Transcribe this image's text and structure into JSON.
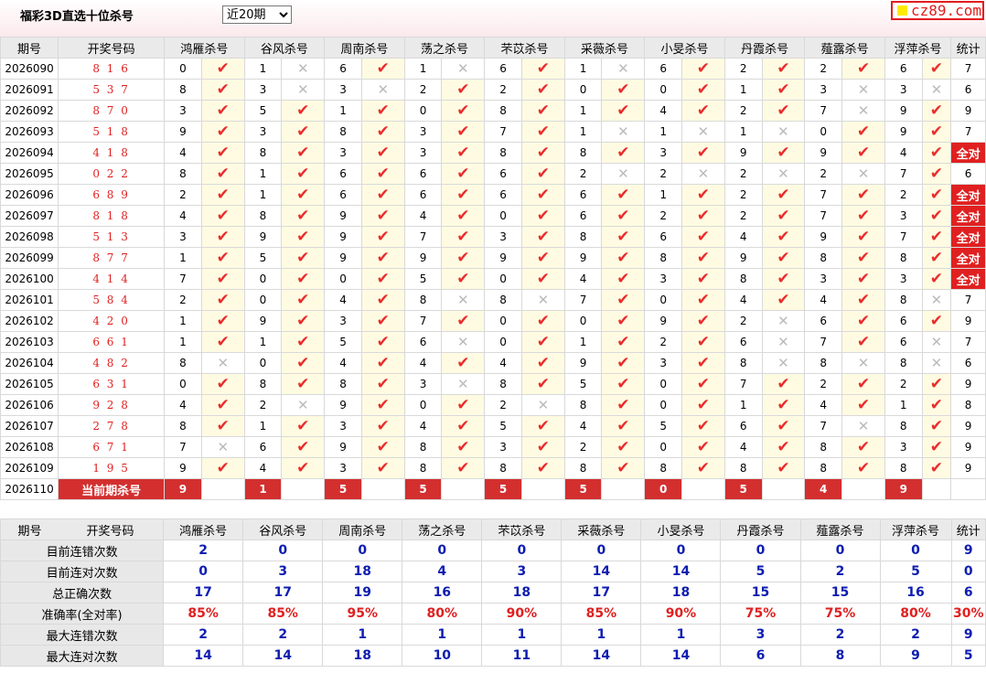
{
  "header": {
    "title": "福彩3D直选十位杀号",
    "period_select": "近20期",
    "logo_text": "cz89.com"
  },
  "columns": [
    "期号",
    "开奖号码",
    "鸿雁杀号",
    "谷风杀号",
    "周南杀号",
    "荡之杀号",
    "芣苡杀号",
    "采薇杀号",
    "小旻杀号",
    "丹霞杀号",
    "薤露杀号",
    "浮萍杀号",
    "统计"
  ],
  "experts": [
    "鸿雁杀号",
    "谷风杀号",
    "周南杀号",
    "荡之杀号",
    "芣苡杀号",
    "采薇杀号",
    "小旻杀号",
    "丹霞杀号",
    "薤露杀号",
    "浮萍杀号"
  ],
  "all_right_text": "全对",
  "rows": [
    {
      "issue": "2026090",
      "draw": "8 1 6",
      "kills": [
        0,
        1,
        6,
        1,
        6,
        1,
        6,
        2,
        2,
        6
      ],
      "ok": [
        1,
        0,
        1,
        0,
        1,
        0,
        1,
        1,
        1,
        1
      ],
      "count": "7"
    },
    {
      "issue": "2026091",
      "draw": "5 3 7",
      "kills": [
        8,
        3,
        3,
        2,
        2,
        0,
        0,
        1,
        3,
        3
      ],
      "ok": [
        1,
        0,
        0,
        1,
        1,
        1,
        1,
        1,
        0,
        0
      ],
      "count": "6"
    },
    {
      "issue": "2026092",
      "draw": "8 7 0",
      "kills": [
        3,
        5,
        1,
        0,
        8,
        1,
        4,
        2,
        7,
        9
      ],
      "ok": [
        1,
        1,
        1,
        1,
        1,
        1,
        1,
        1,
        0,
        1
      ],
      "count": "9"
    },
    {
      "issue": "2026093",
      "draw": "5 1 8",
      "kills": [
        9,
        3,
        8,
        3,
        7,
        1,
        1,
        1,
        0,
        9
      ],
      "ok": [
        1,
        1,
        1,
        1,
        1,
        0,
        0,
        0,
        1,
        1
      ],
      "count": "7"
    },
    {
      "issue": "2026094",
      "draw": "4 1 8",
      "kills": [
        4,
        8,
        3,
        3,
        8,
        8,
        3,
        9,
        9,
        4
      ],
      "ok": [
        1,
        1,
        1,
        1,
        1,
        1,
        1,
        1,
        1,
        1
      ],
      "count": "全对"
    },
    {
      "issue": "2026095",
      "draw": "0 2 2",
      "kills": [
        8,
        1,
        6,
        6,
        6,
        2,
        2,
        2,
        2,
        7
      ],
      "ok": [
        1,
        1,
        1,
        1,
        1,
        0,
        0,
        0,
        0,
        1
      ],
      "count": "6"
    },
    {
      "issue": "2026096",
      "draw": "6 8 9",
      "kills": [
        2,
        1,
        6,
        6,
        6,
        6,
        1,
        2,
        7,
        2
      ],
      "ok": [
        1,
        1,
        1,
        1,
        1,
        1,
        1,
        1,
        1,
        1
      ],
      "count": "全对"
    },
    {
      "issue": "2026097",
      "draw": "8 1 8",
      "kills": [
        4,
        8,
        9,
        4,
        0,
        6,
        2,
        2,
        7,
        3
      ],
      "ok": [
        1,
        1,
        1,
        1,
        1,
        1,
        1,
        1,
        1,
        1
      ],
      "count": "全对"
    },
    {
      "issue": "2026098",
      "draw": "5 1 3",
      "kills": [
        3,
        9,
        9,
        7,
        3,
        8,
        6,
        4,
        9,
        7
      ],
      "ok": [
        1,
        1,
        1,
        1,
        1,
        1,
        1,
        1,
        1,
        1
      ],
      "count": "全对"
    },
    {
      "issue": "2026099",
      "draw": "8 7 7",
      "kills": [
        1,
        5,
        9,
        9,
        9,
        9,
        8,
        9,
        8,
        8
      ],
      "ok": [
        1,
        1,
        1,
        1,
        1,
        1,
        1,
        1,
        1,
        1
      ],
      "count": "全对"
    },
    {
      "issue": "2026100",
      "draw": "4 1 4",
      "kills": [
        7,
        0,
        0,
        5,
        0,
        4,
        3,
        8,
        3,
        3
      ],
      "ok": [
        1,
        1,
        1,
        1,
        1,
        1,
        1,
        1,
        1,
        1
      ],
      "count": "全对"
    },
    {
      "issue": "2026101",
      "draw": "5 8 4",
      "kills": [
        2,
        0,
        4,
        8,
        8,
        7,
        0,
        4,
        4,
        8
      ],
      "ok": [
        1,
        1,
        1,
        0,
        0,
        1,
        1,
        1,
        1,
        0
      ],
      "count": "7"
    },
    {
      "issue": "2026102",
      "draw": "4 2 0",
      "kills": [
        1,
        9,
        3,
        7,
        0,
        0,
        9,
        2,
        6,
        6
      ],
      "ok": [
        1,
        1,
        1,
        1,
        1,
        1,
        1,
        0,
        1,
        1
      ],
      "count": "9"
    },
    {
      "issue": "2026103",
      "draw": "6 6 1",
      "kills": [
        1,
        1,
        5,
        6,
        0,
        1,
        2,
        6,
        7,
        6
      ],
      "ok": [
        1,
        1,
        1,
        0,
        1,
        1,
        1,
        0,
        1,
        0
      ],
      "count": "7"
    },
    {
      "issue": "2026104",
      "draw": "4 8 2",
      "kills": [
        8,
        0,
        4,
        4,
        4,
        9,
        3,
        8,
        8,
        8
      ],
      "ok": [
        0,
        1,
        1,
        1,
        1,
        1,
        1,
        0,
        0,
        0
      ],
      "count": "6"
    },
    {
      "issue": "2026105",
      "draw": "6 3 1",
      "kills": [
        0,
        8,
        8,
        3,
        8,
        5,
        0,
        7,
        2,
        2
      ],
      "ok": [
        1,
        1,
        1,
        0,
        1,
        1,
        1,
        1,
        1,
        1
      ],
      "count": "9"
    },
    {
      "issue": "2026106",
      "draw": "9 2 8",
      "kills": [
        4,
        2,
        9,
        0,
        2,
        8,
        0,
        1,
        4,
        1
      ],
      "ok": [
        1,
        0,
        1,
        1,
        0,
        1,
        1,
        1,
        1,
        1
      ],
      "count": "8"
    },
    {
      "issue": "2026107",
      "draw": "2 7 8",
      "kills": [
        8,
        1,
        3,
        4,
        5,
        4,
        5,
        6,
        7,
        8
      ],
      "ok": [
        1,
        1,
        1,
        1,
        1,
        1,
        1,
        1,
        0,
        1
      ],
      "count": "9"
    },
    {
      "issue": "2026108",
      "draw": "6 7 1",
      "kills": [
        7,
        6,
        9,
        8,
        3,
        2,
        0,
        4,
        8,
        3
      ],
      "ok": [
        0,
        1,
        1,
        1,
        1,
        1,
        1,
        1,
        1,
        1
      ],
      "count": "9"
    },
    {
      "issue": "2026109",
      "draw": "1 9 5",
      "kills": [
        9,
        4,
        3,
        8,
        8,
        8,
        8,
        8,
        8,
        8
      ],
      "ok": [
        1,
        1,
        1,
        1,
        1,
        1,
        1,
        1,
        1,
        1
      ],
      "count": "9"
    }
  ],
  "current": {
    "issue": "2026110",
    "label": "当前期杀号",
    "kills": [
      "9",
      "1",
      "5",
      "5",
      "5",
      "5",
      "0",
      "5",
      "4",
      "9"
    ]
  },
  "stats": [
    {
      "label": "目前连错次数",
      "values": [
        "2",
        "0",
        "0",
        "0",
        "0",
        "0",
        "0",
        "0",
        "0",
        "0",
        "9"
      ]
    },
    {
      "label": "目前连对次数",
      "values": [
        "0",
        "3",
        "18",
        "4",
        "3",
        "14",
        "14",
        "5",
        "2",
        "5",
        "0"
      ]
    },
    {
      "label": "总正确次数",
      "values": [
        "17",
        "17",
        "19",
        "16",
        "18",
        "17",
        "18",
        "15",
        "15",
        "16",
        "6"
      ]
    },
    {
      "label": "准确率(全对率)",
      "values": [
        "85%",
        "85%",
        "95%",
        "80%",
        "90%",
        "85%",
        "90%",
        "75%",
        "75%",
        "80%",
        "30%"
      ],
      "rate": true
    },
    {
      "label": "最大连错次数",
      "values": [
        "2",
        "2",
        "1",
        "1",
        "1",
        "1",
        "1",
        "3",
        "2",
        "2",
        "9"
      ]
    },
    {
      "label": "最大连对次数",
      "values": [
        "14",
        "14",
        "18",
        "10",
        "11",
        "14",
        "14",
        "6",
        "8",
        "9",
        "5"
      ]
    }
  ]
}
